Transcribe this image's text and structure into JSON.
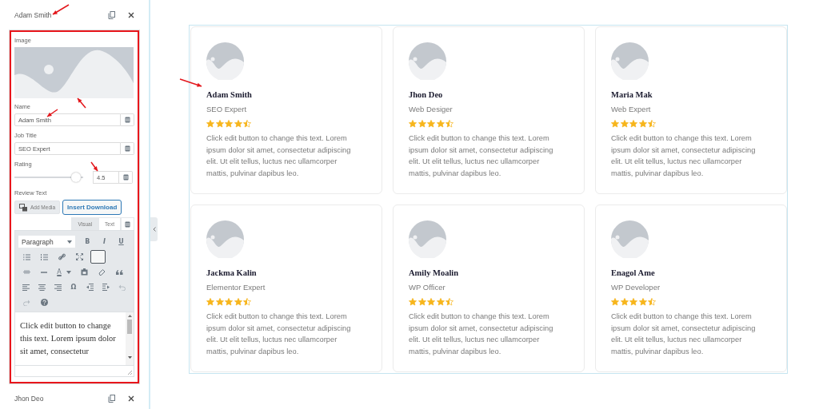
{
  "repeater_items": [
    {
      "title": "Adam Smith",
      "expanded": true
    },
    {
      "title": "Jhon Deo",
      "expanded": false
    }
  ],
  "item_form": {
    "image_label": "Image",
    "name_label": "Name",
    "name_value": "Adam Smith",
    "job_label": "Job Title",
    "job_value": "SEO Expert",
    "rating_label": "Rating",
    "rating": {
      "level": 0.9
    },
    "rating_value": "4.5",
    "review_label": "Review Text",
    "add_media": "Add Media",
    "insert_download": "Insert Download",
    "editor_tabs": [
      {
        "label": "Visual",
        "selected": true
      },
      {
        "label": "Text",
        "selected": false
      }
    ],
    "format_select": "Paragraph",
    "toolbar_labels": [
      "B",
      "I",
      "U",
      "A",
      "Ω"
    ],
    "editor_text": "Click edit button to change this text. Lorem ipsum dolor sit amet, consectetur"
  },
  "cards": [
    {
      "name": "Adam Smith",
      "job": "SEO Expert",
      "stars": 4.5,
      "text": "Click edit button to change this text. Lorem ipsum dolor sit amet, consectetur adipiscing elit. Ut elit tellus, luctus nec ullamcorper mattis, pulvinar dapibus leo."
    },
    {
      "name": "Jhon Deo",
      "job": "Web Desiger",
      "stars": 4.5,
      "text": "Click edit button to change this text. Lorem ipsum dolor sit amet, consectetur adipiscing elit. Ut elit tellus, luctus nec ullamcorper mattis, pulvinar dapibus leo."
    },
    {
      "name": "Maria Mak",
      "job": "Web Expert",
      "stars": 4.5,
      "text": "Click edit button to change this text. Lorem ipsum dolor sit amet, consectetur adipiscing elit. Ut elit tellus, luctus nec ullamcorper mattis, pulvinar dapibus leo."
    },
    {
      "name": "Jackma Kalin",
      "job": "Elementor Expert",
      "stars": 4.5,
      "text": "Click edit button to change this text. Lorem ipsum dolor sit amet, consectetur adipiscing elit. Ut elit tellus, luctus nec ullamcorper mattis, pulvinar dapibus leo."
    },
    {
      "name": "Amily Moalin",
      "job": "WP Officer",
      "stars": 4.5,
      "text": "Click edit button to change this text. Lorem ipsum dolor sit amet, consectetur adipiscing elit. Ut elit tellus, luctus nec ullamcorper mattis, pulvinar dapibus leo."
    },
    {
      "name": "Enagol Ame",
      "job": "WP Developer",
      "stars": 4.5,
      "text": "Click edit button to change this text. Lorem ipsum dolor sit amet, consectetur adipiscing elit. Ut elit tellus, luctus nec ullamcorper mattis, pulvinar dapibus leo."
    }
  ]
}
